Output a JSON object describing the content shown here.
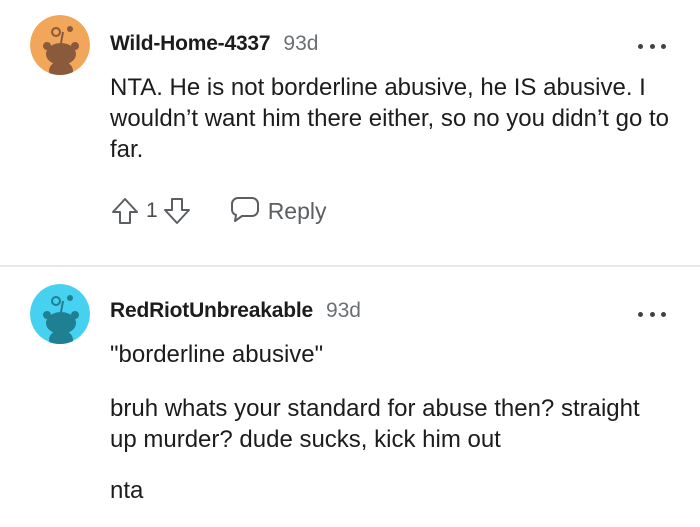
{
  "comments": [
    {
      "username": "Wild-Home-4337",
      "age": "93d",
      "avatar_icon": "snoo-avatar-orange",
      "avatar_bg": "#f2a65a",
      "paragraphs": [
        "NTA. He is not borderline abusive, he IS abusive. I wouldn’t want him there either, so no you didn’t go to far."
      ],
      "score": "1",
      "reply_label": "Reply"
    },
    {
      "username": "RedRiotUnbreakable",
      "age": "93d",
      "avatar_icon": "snoo-avatar-cyan",
      "avatar_bg": "#46d1f0",
      "paragraphs": [
        "\"borderline abusive\"",
        "bruh whats your standard for abuse then? straight up murder? dude sucks, kick him out",
        "nta"
      ]
    }
  ],
  "colors": {
    "text": "#1c1c1c",
    "meta": "#6b6f73",
    "divider": "#e6e8ea"
  }
}
